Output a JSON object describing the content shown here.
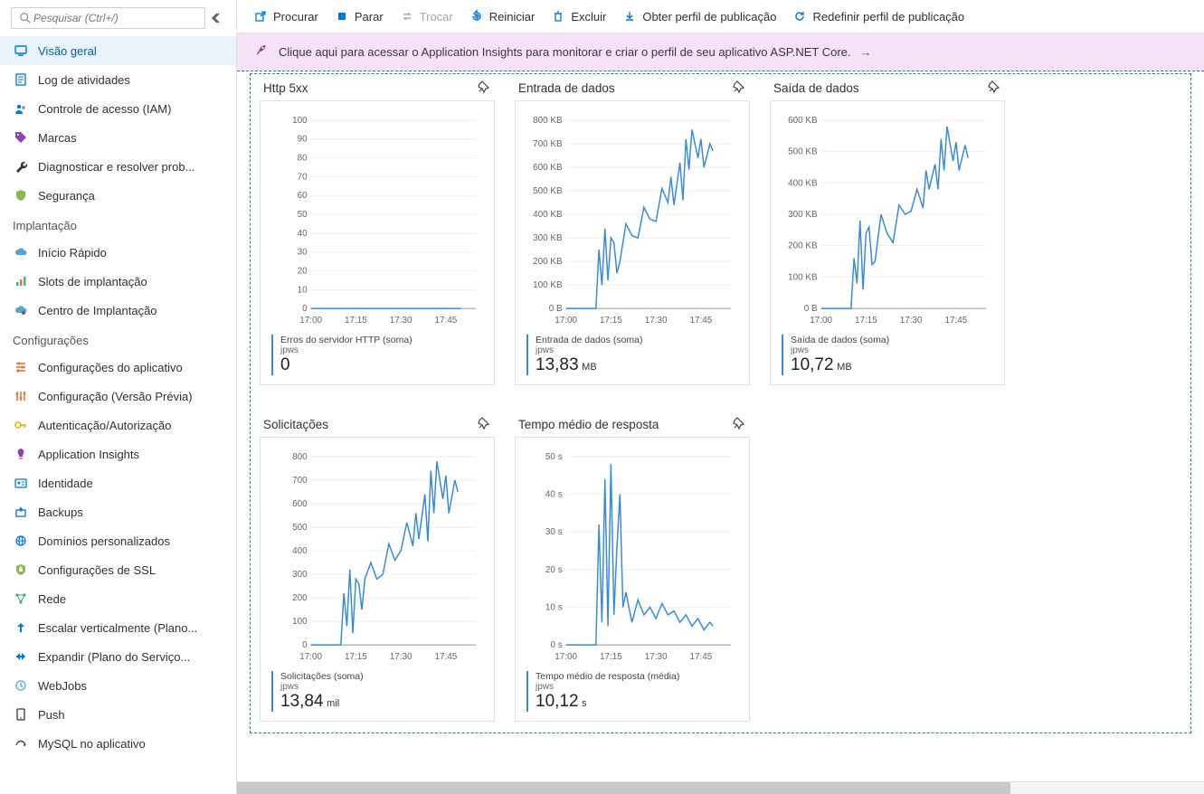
{
  "search": {
    "placeholder": "Pesquisar (Ctrl+/)"
  },
  "nav": {
    "general": [
      {
        "id": "overview",
        "label": "Visão geral",
        "active": true,
        "icon": "monitor",
        "color": "#0078d4"
      },
      {
        "id": "activity-log",
        "label": "Log de atividades",
        "icon": "log",
        "color": "#0078d4"
      },
      {
        "id": "iam",
        "label": "Controle de acesso (IAM)",
        "icon": "people",
        "color": "#0078d4"
      },
      {
        "id": "tags",
        "label": "Marcas",
        "icon": "tag",
        "color": "#8e44ad"
      },
      {
        "id": "diagnose",
        "label": "Diagnosticar e resolver prob...",
        "icon": "wrench",
        "color": "#333"
      },
      {
        "id": "security",
        "label": "Segurança",
        "icon": "shield",
        "color": "#8ab84f"
      }
    ],
    "sections": [
      {
        "title": "Implantação",
        "items": [
          {
            "id": "quickstart",
            "label": "Início Rápido",
            "icon": "cloud",
            "color": "#5aa2d4"
          },
          {
            "id": "slots",
            "label": "Slots de implantação",
            "icon": "bars",
            "color": "#e07b3a"
          },
          {
            "id": "deploy-center",
            "label": "Centro de Implantação",
            "icon": "gear-cloud",
            "color": "#5aa2d4"
          }
        ]
      },
      {
        "title": "Configurações",
        "items": [
          {
            "id": "app-settings",
            "label": "Configurações do aplicativo",
            "icon": "sliders",
            "color": "#e07b3a"
          },
          {
            "id": "config-preview",
            "label": "Configuração (Versão Prévia)",
            "icon": "sliders2",
            "color": "#e07b3a"
          },
          {
            "id": "auth",
            "label": "Autenticação/Autorização",
            "icon": "key",
            "color": "#e3b505"
          },
          {
            "id": "app-insights",
            "label": "Application Insights",
            "icon": "bulb",
            "color": "#8e44ad"
          },
          {
            "id": "identity",
            "label": "Identidade",
            "icon": "id",
            "color": "#0078d4"
          },
          {
            "id": "backups",
            "label": "Backups",
            "icon": "backup",
            "color": "#0078d4"
          },
          {
            "id": "domains",
            "label": "Domínios personalizados",
            "icon": "globe-doc",
            "color": "#0078d4"
          },
          {
            "id": "ssl",
            "label": "Configurações de SSL",
            "icon": "ssl-shield",
            "color": "#8ab84f"
          },
          {
            "id": "network",
            "label": "Rede",
            "icon": "network",
            "color": "#2aa876"
          },
          {
            "id": "scale-up",
            "label": "Escalar verticalmente (Plano...",
            "icon": "scale-up",
            "color": "#0078d4"
          },
          {
            "id": "scale-out",
            "label": "Expandir (Plano do Serviço...",
            "icon": "scale-out",
            "color": "#0078d4"
          },
          {
            "id": "webjobs",
            "label": "WebJobs",
            "icon": "webjobs",
            "color": "#5aa2d4"
          },
          {
            "id": "push",
            "label": "Push",
            "icon": "push",
            "color": "#333"
          },
          {
            "id": "mysql",
            "label": "MySQL no aplicativo",
            "icon": "mysql",
            "color": "#444"
          }
        ]
      }
    ]
  },
  "toolbar": [
    {
      "id": "browse",
      "label": "Procurar",
      "icon": "external",
      "color": "#0078d4"
    },
    {
      "id": "stop",
      "label": "Parar",
      "icon": "stop",
      "color": "#0078d4"
    },
    {
      "id": "swap",
      "label": "Trocar",
      "icon": "swap",
      "color": "#a6a6a6",
      "disabled": true
    },
    {
      "id": "restart",
      "label": "Reiniciar",
      "icon": "restart",
      "color": "#0078d4"
    },
    {
      "id": "delete",
      "label": "Excluir",
      "icon": "trash",
      "color": "#0078d4"
    },
    {
      "id": "get-profile",
      "label": "Obter perfil de publicação",
      "icon": "download",
      "color": "#0078d4"
    },
    {
      "id": "reset-profile",
      "label": "Redefinir perfil de publicação",
      "icon": "reset",
      "color": "#0078d4"
    }
  ],
  "banner": {
    "text": "Clique aqui para acessar o Application Insights para monitorar e criar o perfil de seu aplicativo ASP.NET Core."
  },
  "tiles": [
    {
      "title": "Http 5xx",
      "metric_name": "Erros do servidor HTTP (soma)",
      "metric_sub": "jpws",
      "metric_value": "0",
      "metric_unit": "",
      "chart_id": 0
    },
    {
      "title": "Entrada de dados",
      "metric_name": "Entrada de dados (soma)",
      "metric_sub": "jpws",
      "metric_value": "13,83",
      "metric_unit": "MB",
      "chart_id": 1
    },
    {
      "title": "Saída de dados",
      "metric_name": "Saída de dados (soma)",
      "metric_sub": "jpws",
      "metric_value": "10,72",
      "metric_unit": "MB",
      "chart_id": 2
    },
    {
      "title": "Solicitações",
      "metric_name": "Solicitações (soma)",
      "metric_sub": "jpws",
      "metric_value": "13,84",
      "metric_unit": "mil",
      "chart_id": 3
    },
    {
      "title": "Tempo médio de resposta",
      "metric_name": "Tempo médio de resposta (média)",
      "metric_sub": "jpws",
      "metric_value": "10,12",
      "metric_unit": "s",
      "chart_id": 4
    }
  ],
  "chart_data": [
    {
      "type": "line",
      "title": "Http 5xx",
      "x_ticks": [
        "17:00",
        "17:15",
        "17:30",
        "17:45"
      ],
      "y_ticks": [
        0,
        10,
        20,
        30,
        40,
        50,
        60,
        70,
        80,
        90,
        100
      ],
      "ylim": [
        0,
        100
      ],
      "ylabel": "",
      "series": [
        {
          "name": "Erros do servidor HTTP (soma)",
          "values": [
            [
              1700,
              0
            ],
            [
              1705,
              0
            ],
            [
              1710,
              0
            ],
            [
              1715,
              0
            ],
            [
              1720,
              0
            ],
            [
              1725,
              0
            ],
            [
              1730,
              0
            ],
            [
              1735,
              0
            ],
            [
              1740,
              0
            ],
            [
              1745,
              0
            ],
            [
              1750,
              0
            ]
          ]
        }
      ]
    },
    {
      "type": "line",
      "title": "Entrada de dados",
      "x_ticks": [
        "17:00",
        "17:15",
        "17:30",
        "17:45"
      ],
      "y_ticks": [
        "0 B",
        "100 KB",
        "200 KB",
        "300 KB",
        "400 KB",
        "500 KB",
        "600 KB",
        "700 KB",
        "800 KB"
      ],
      "ylim": [
        0,
        800
      ],
      "ylabel": "",
      "series": [
        {
          "name": "Entrada de dados (soma)",
          "values": [
            [
              1700,
              0
            ],
            [
              1708,
              0
            ],
            [
              1710,
              0
            ],
            [
              1711,
              250
            ],
            [
              1712,
              100
            ],
            [
              1713,
              340
            ],
            [
              1714,
              120
            ],
            [
              1715,
              300
            ],
            [
              1716,
              280
            ],
            [
              1717,
              150
            ],
            [
              1718,
              200
            ],
            [
              1720,
              360
            ],
            [
              1722,
              310
            ],
            [
              1724,
              300
            ],
            [
              1726,
              430
            ],
            [
              1728,
              380
            ],
            [
              1730,
              370
            ],
            [
              1732,
              510
            ],
            [
              1734,
              450
            ],
            [
              1735,
              560
            ],
            [
              1736,
              440
            ],
            [
              1738,
              620
            ],
            [
              1739,
              460
            ],
            [
              1740,
              720
            ],
            [
              1741,
              590
            ],
            [
              1742,
              760
            ],
            [
              1744,
              640
            ],
            [
              1745,
              720
            ],
            [
              1746,
              600
            ],
            [
              1748,
              700
            ],
            [
              1749,
              670
            ]
          ]
        }
      ]
    },
    {
      "type": "line",
      "title": "Saída de dados",
      "x_ticks": [
        "17:00",
        "17:15",
        "17:30",
        "17:45"
      ],
      "y_ticks": [
        "0 B",
        "100 KB",
        "200 KB",
        "300 KB",
        "400 KB",
        "500 KB",
        "600 KB"
      ],
      "ylim": [
        0,
        600
      ],
      "ylabel": "",
      "series": [
        {
          "name": "Saída de dados (soma)",
          "values": [
            [
              1700,
              0
            ],
            [
              1708,
              0
            ],
            [
              1710,
              0
            ],
            [
              1711,
              160
            ],
            [
              1712,
              80
            ],
            [
              1713,
              280
            ],
            [
              1714,
              60
            ],
            [
              1715,
              240
            ],
            [
              1716,
              260
            ],
            [
              1717,
              140
            ],
            [
              1718,
              150
            ],
            [
              1720,
              300
            ],
            [
              1722,
              240
            ],
            [
              1724,
              210
            ],
            [
              1726,
              330
            ],
            [
              1728,
              300
            ],
            [
              1730,
              310
            ],
            [
              1732,
              380
            ],
            [
              1734,
              320
            ],
            [
              1735,
              440
            ],
            [
              1736,
              380
            ],
            [
              1738,
              460
            ],
            [
              1739,
              380
            ],
            [
              1740,
              540
            ],
            [
              1741,
              440
            ],
            [
              1742,
              580
            ],
            [
              1744,
              470
            ],
            [
              1745,
              530
            ],
            [
              1746,
              440
            ],
            [
              1748,
              520
            ],
            [
              1749,
              480
            ]
          ]
        }
      ]
    },
    {
      "type": "line",
      "title": "Solicitações",
      "x_ticks": [
        "17:00",
        "17:15",
        "17:30",
        "17:45"
      ],
      "y_ticks": [
        0,
        100,
        200,
        300,
        400,
        500,
        600,
        700,
        800
      ],
      "ylim": [
        0,
        800
      ],
      "ylabel": "",
      "series": [
        {
          "name": "Solicitações (soma)",
          "values": [
            [
              1700,
              0
            ],
            [
              1708,
              0
            ],
            [
              1710,
              0
            ],
            [
              1711,
              220
            ],
            [
              1712,
              80
            ],
            [
              1713,
              320
            ],
            [
              1714,
              50
            ],
            [
              1715,
              280
            ],
            [
              1716,
              260
            ],
            [
              1717,
              150
            ],
            [
              1718,
              280
            ],
            [
              1720,
              350
            ],
            [
              1722,
              280
            ],
            [
              1724,
              300
            ],
            [
              1726,
              430
            ],
            [
              1728,
              360
            ],
            [
              1730,
              400
            ],
            [
              1732,
              520
            ],
            [
              1734,
              420
            ],
            [
              1735,
              560
            ],
            [
              1736,
              450
            ],
            [
              1738,
              640
            ],
            [
              1739,
              440
            ],
            [
              1740,
              740
            ],
            [
              1741,
              560
            ],
            [
              1742,
              780
            ],
            [
              1744,
              620
            ],
            [
              1745,
              720
            ],
            [
              1746,
              560
            ],
            [
              1748,
              700
            ],
            [
              1749,
              650
            ]
          ]
        }
      ]
    },
    {
      "type": "line",
      "title": "Tempo médio de resposta",
      "x_ticks": [
        "17:00",
        "17:15",
        "17:30",
        "17:45"
      ],
      "y_ticks": [
        "0 s",
        "10 s",
        "20 s",
        "30 s",
        "40 s",
        "50 s"
      ],
      "ylim": [
        0,
        50
      ],
      "ylabel": "",
      "series": [
        {
          "name": "Tempo médio de resposta (média)",
          "values": [
            [
              1700,
              0
            ],
            [
              1708,
              0
            ],
            [
              1710,
              0
            ],
            [
              1711,
              32
            ],
            [
              1712,
              6
            ],
            [
              1713,
              44
            ],
            [
              1714,
              5
            ],
            [
              1715,
              48
            ],
            [
              1716,
              8
            ],
            [
              1717,
              26
            ],
            [
              1718,
              40
            ],
            [
              1719,
              10
            ],
            [
              1720,
              14
            ],
            [
              1722,
              6
            ],
            [
              1724,
              12
            ],
            [
              1726,
              8
            ],
            [
              1728,
              10
            ],
            [
              1730,
              7
            ],
            [
              1732,
              11
            ],
            [
              1734,
              8
            ],
            [
              1736,
              9
            ],
            [
              1738,
              6
            ],
            [
              1740,
              8
            ],
            [
              1742,
              5
            ],
            [
              1744,
              7
            ],
            [
              1746,
              4
            ],
            [
              1748,
              6
            ],
            [
              1749,
              5
            ]
          ]
        }
      ]
    }
  ]
}
